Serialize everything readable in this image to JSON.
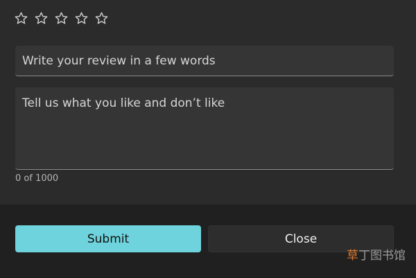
{
  "rating": {
    "max_stars": 5,
    "value": 0,
    "star_color": "#cfcfcf"
  },
  "review": {
    "title_placeholder": "Write your review in a few words",
    "title_value": "",
    "body_placeholder": "Tell us what you like and don’t like",
    "body_value": "",
    "counter": "0 of 1000"
  },
  "buttons": {
    "submit_label": "Submit",
    "close_label": "Close"
  },
  "colors": {
    "accent": "#6ed3dc",
    "background": "#2b2b2b",
    "footer": "#202020",
    "field": "#353535"
  },
  "watermark": {
    "part1": "草",
    "part2": "丁图书馆"
  }
}
